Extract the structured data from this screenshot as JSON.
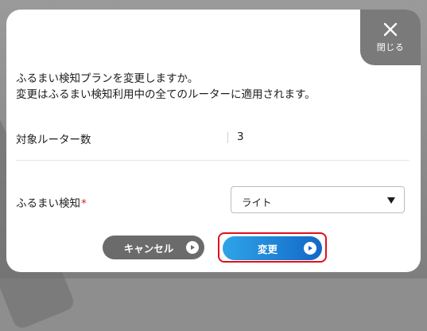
{
  "dialog": {
    "close_label": "閉じる",
    "message_line1": "ふるまい検知プランを変更しますか。",
    "message_line2": "変更はふるまい検知利用中の全てのルーターに適用されます。",
    "target_routers_label": "対象ルーター数",
    "target_routers_value": "3",
    "behavior_label": "ふるまい検知",
    "required_mark": "*",
    "behavior_selected": "ライト",
    "cancel_label": "キャンセル",
    "change_label": "変更"
  },
  "colors": {
    "cancel_button": "#6b6b6b",
    "change_button_start": "#2fa4e7",
    "change_button_end": "#1268c8",
    "highlight_outline": "#e0101a",
    "required": "#d4202a",
    "close_button": "#7a7a7a"
  },
  "icons": {
    "close": "close-icon",
    "button_play": "play-circle-icon",
    "select_arrow": "caret-down-icon"
  }
}
